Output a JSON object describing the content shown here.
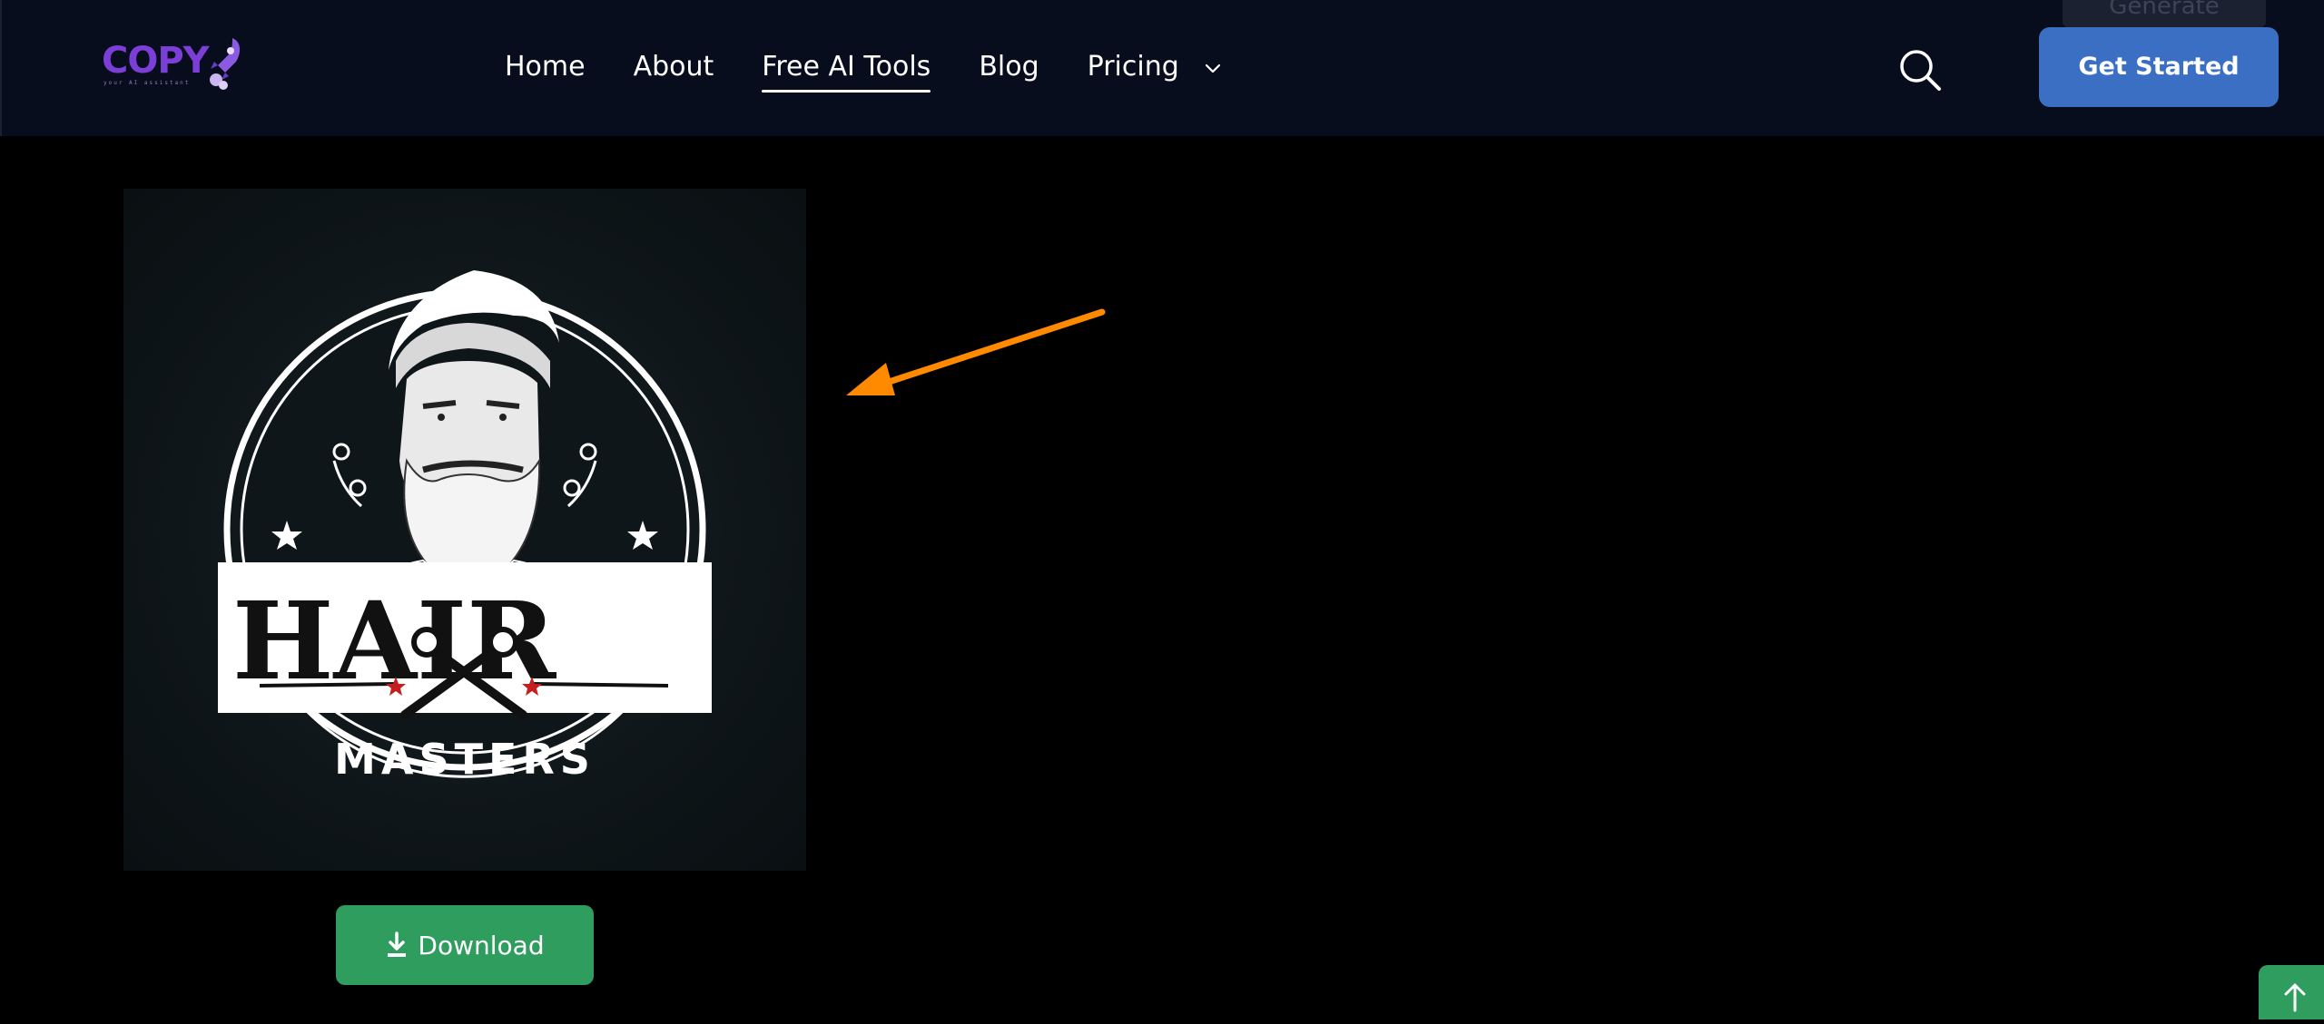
{
  "header": {
    "logo": {
      "text": "COPY",
      "tagline": "your AI assistant"
    },
    "nav": [
      {
        "label": "Home",
        "active": false
      },
      {
        "label": "About",
        "active": false
      },
      {
        "label": "Free AI Tools",
        "active": true
      },
      {
        "label": "Blog",
        "active": false
      },
      {
        "label": "Pricing",
        "active": false
      }
    ],
    "more_icon": "chevron-down-icon",
    "search_icon": "search-icon",
    "ghost_button_label": "Generate",
    "cta_label": "Get Started"
  },
  "result": {
    "logo_image": {
      "top_text": "HAIR",
      "bottom_text": "MASTERS"
    },
    "download_label": "Download",
    "download_icon": "download-icon"
  },
  "annotation": {
    "icon": "arrow-pointer-icon",
    "color": "#ff8a00"
  },
  "scroll_top_icon": "arrow-up-icon",
  "colors": {
    "nav_bg": "#070d1c",
    "cta": "#3a6fc4",
    "download": "#2f9d5e",
    "brand": "#7b3fd8"
  }
}
